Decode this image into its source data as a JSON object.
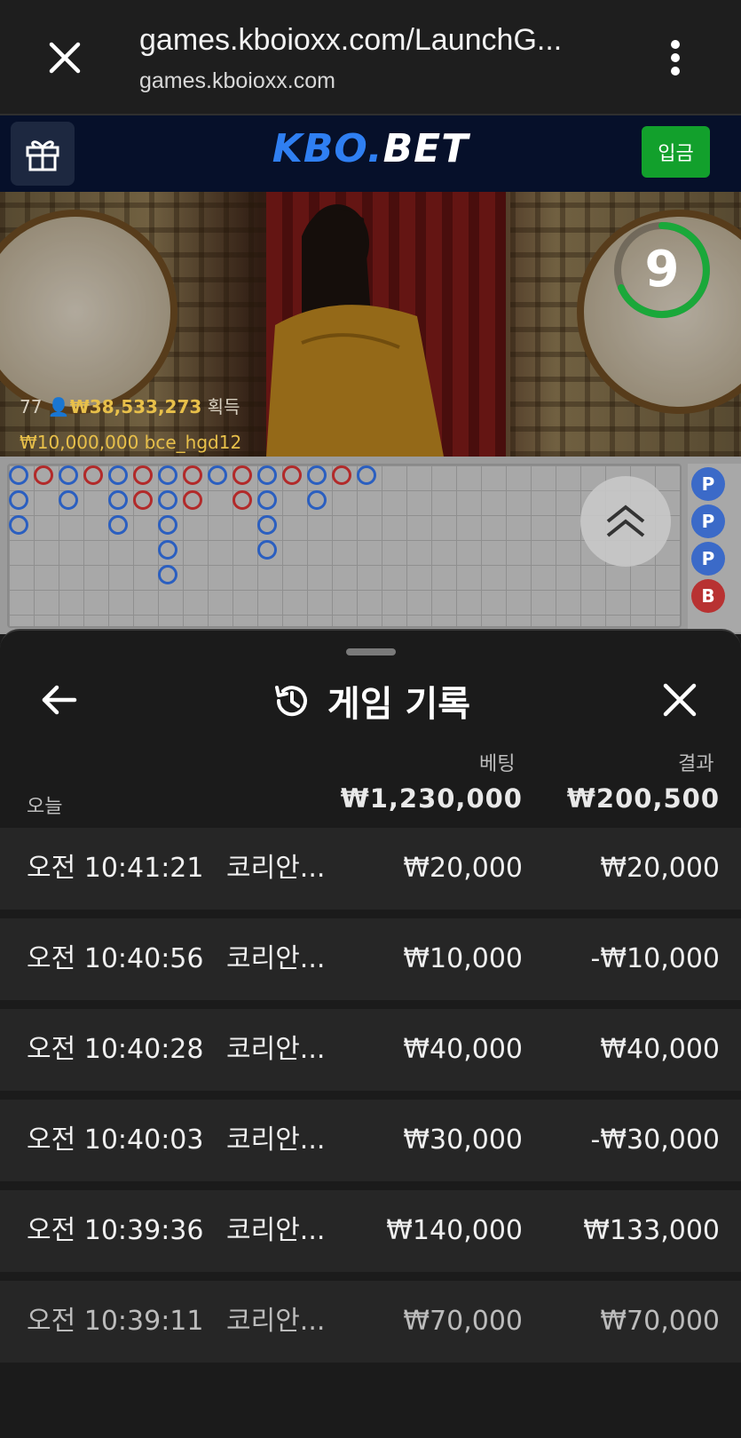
{
  "browser": {
    "url": "games.kboioxx.com/LaunchG...",
    "domain": "games.kboioxx.com"
  },
  "site": {
    "logo_part1": "KBO.",
    "logo_part2": "BET",
    "deposit_label": "입금"
  },
  "video": {
    "players": "77",
    "winnings": "₩38,533,273",
    "winnings_suffix": "획득",
    "winner_amount": "₩10,000,000",
    "winner_name": "bce_hgd12",
    "countdown": "9"
  },
  "road": {
    "side_labels": [
      "P",
      "P",
      "P",
      "B"
    ]
  },
  "history": {
    "title": "게임 기록",
    "col_bet": "베팅",
    "col_result": "결과",
    "today_label": "오늘",
    "total_bet": "₩1,230,000",
    "total_result": "₩200,500",
    "rows": [
      {
        "time": "오전 10:41:21",
        "game": "코리안...",
        "bet": "₩20,000",
        "result": "₩20,000"
      },
      {
        "time": "오전 10:40:56",
        "game": "코리안...",
        "bet": "₩10,000",
        "result": "-₩10,000"
      },
      {
        "time": "오전 10:40:28",
        "game": "코리안...",
        "bet": "₩40,000",
        "result": "₩40,000"
      },
      {
        "time": "오전 10:40:03",
        "game": "코리안...",
        "bet": "₩30,000",
        "result": "-₩30,000"
      },
      {
        "time": "오전 10:39:36",
        "game": "코리안...",
        "bet": "₩140,000",
        "result": "₩133,000"
      },
      {
        "time": "오전 10:39:11",
        "game": "코리안...",
        "bet": "₩70,000",
        "result": "₩70,000"
      }
    ]
  },
  "colors": {
    "brand_blue": "#2f7ff2",
    "deposit_green": "#12a02c",
    "player_blue": "#2b5fc0",
    "banker_red": "#b22a2a"
  }
}
